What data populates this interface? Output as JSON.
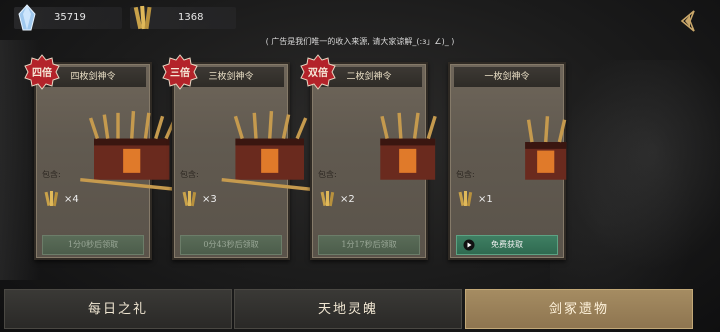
{
  "currencies": [
    {
      "icon": "crystal-icon",
      "value": "35719"
    },
    {
      "icon": "sword-token-icon",
      "value": "1368"
    }
  ],
  "notice": "( 广告是我们唯一的收入来源, 请大家谅解_(:з」∠)_ )",
  "cards": [
    {
      "title": "四枚剑神令",
      "badge": "四倍",
      "contains": "包含:",
      "count": "×4",
      "button": "1分0秒后领取",
      "active": false
    },
    {
      "title": "三枚剑神令",
      "badge": "三倍",
      "contains": "包含:",
      "count": "×3",
      "button": "0分43秒后领取",
      "active": false
    },
    {
      "title": "二枚剑神令",
      "badge": "双倍",
      "contains": "包含:",
      "count": "×2",
      "button": "1分17秒后领取",
      "active": false
    },
    {
      "title": "一枚剑神令",
      "badge": "",
      "contains": "包含:",
      "count": "×1",
      "button": "免费获取",
      "active": true
    }
  ],
  "tabs": [
    {
      "label": "每日之礼",
      "selected": false
    },
    {
      "label": "天地灵魄",
      "selected": false
    },
    {
      "label": "剑冢遗物",
      "selected": true
    }
  ],
  "colors": {
    "badge_red": "#b3232a",
    "active_button": "#3f7f63",
    "selected_tab": "#a58c62"
  }
}
